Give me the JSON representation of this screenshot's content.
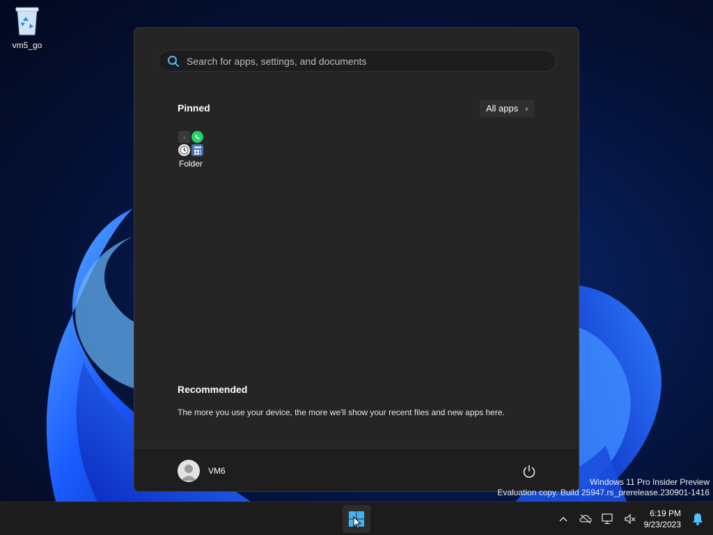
{
  "desktop": {
    "icons": [
      {
        "label": "vm5_go",
        "icon": "recycle-bin-icon"
      }
    ]
  },
  "start_menu": {
    "search": {
      "placeholder": "Search for apps, settings, and documents",
      "value": ""
    },
    "pinned": {
      "title": "Pinned",
      "all_apps_label": "All apps",
      "items": [
        {
          "label": "Folder",
          "icon": "folder-icon"
        }
      ]
    },
    "recommended": {
      "title": "Recommended",
      "message": "The more you use your device, the more we'll show your recent files and new apps here."
    },
    "user": {
      "name": "VM6"
    }
  },
  "watermark": {
    "line1": "Windows 11 Pro Insider Preview",
    "line2": "Evaluation copy. Build 25947.rs_prerelease.230901-1416"
  },
  "taskbar": {
    "time": "6:19 PM",
    "date": "9/23/2023",
    "colors": {
      "accent": "#4cc2ff",
      "start_logo": "#3fb5f5"
    }
  }
}
